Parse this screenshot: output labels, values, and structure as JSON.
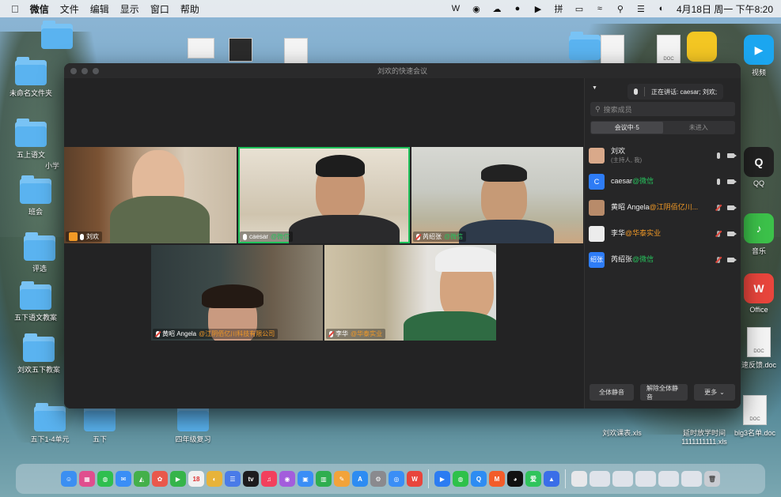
{
  "menubar": {
    "app": "微信",
    "items": [
      "文件",
      "编辑",
      "显示",
      "窗口",
      "帮助"
    ],
    "clock": "4月18日 周一 下午8:20"
  },
  "desktop": {
    "icons": [
      {
        "label": "未命名文件夹",
        "kind": "folder"
      },
      {
        "label": "五上语文",
        "kind": "folder"
      },
      {
        "label": "小学",
        "kind": "folder"
      },
      {
        "label": "班会",
        "kind": "folder"
      },
      {
        "label": "评选",
        "kind": "folder"
      },
      {
        "label": "五下语文教案",
        "kind": "folder"
      },
      {
        "label": "刘欢五下教案",
        "kind": "folder"
      },
      {
        "label": "五下1-4单元",
        "kind": "folder"
      },
      {
        "label": "五下",
        "kind": "folder"
      },
      {
        "label": "四年级复习",
        "kind": "folder"
      },
      {
        "label": "刘欢课表.xls",
        "kind": "doc"
      },
      {
        "label": "延时放学时间 1111111111.xls",
        "kind": "doc"
      },
      {
        "label": "blg3名单.doc",
        "kind": "doc"
      },
      {
        "label": "速反馈.doc",
        "kind": "doc"
      },
      {
        "label": "视频",
        "kind": "app"
      },
      {
        "label": "QQ",
        "kind": "app"
      },
      {
        "label": "音乐",
        "kind": "app"
      },
      {
        "label": "Office",
        "kind": "app"
      }
    ]
  },
  "meeting": {
    "window_title": "刘欢的快速会议",
    "speaking": "正在讲话: caesar; 刘欢;",
    "search_placeholder": "搜索成员",
    "tab_in": "会议中·5",
    "tab_out": "未进入",
    "tiles": [
      {
        "name": "刘欢",
        "org": ""
      },
      {
        "name": "caesar",
        "org": "@微信"
      },
      {
        "name": "芮绍张",
        "org": "@微信"
      },
      {
        "name": "黄昭 Angela",
        "org": "@江阴佰亿川科技有限公司"
      },
      {
        "name": "李华",
        "org": "@华泰实业"
      }
    ],
    "members": [
      {
        "name": "刘欢",
        "sub": "(主持人, 我)",
        "org": "",
        "avatar": ""
      },
      {
        "name": "caesar",
        "sub": "",
        "org": "@微信",
        "avatar": "C"
      },
      {
        "name": "黄昭 Angela",
        "sub": "",
        "org": "@江阴佰亿川...",
        "avatar": ""
      },
      {
        "name": "李华",
        "sub": "",
        "org": "@华泰实业",
        "avatar": ""
      },
      {
        "name": "芮绍张",
        "sub": "",
        "org": "@微信",
        "avatar": "绍张"
      }
    ],
    "buttons": {
      "mute_all": "全体静音",
      "unmute_all": "解除全体静音",
      "more": "更多"
    }
  },
  "colors": {
    "accent_green": "#1fc15a",
    "org_orange": "#f39a26",
    "panel_bg": "#262627"
  }
}
